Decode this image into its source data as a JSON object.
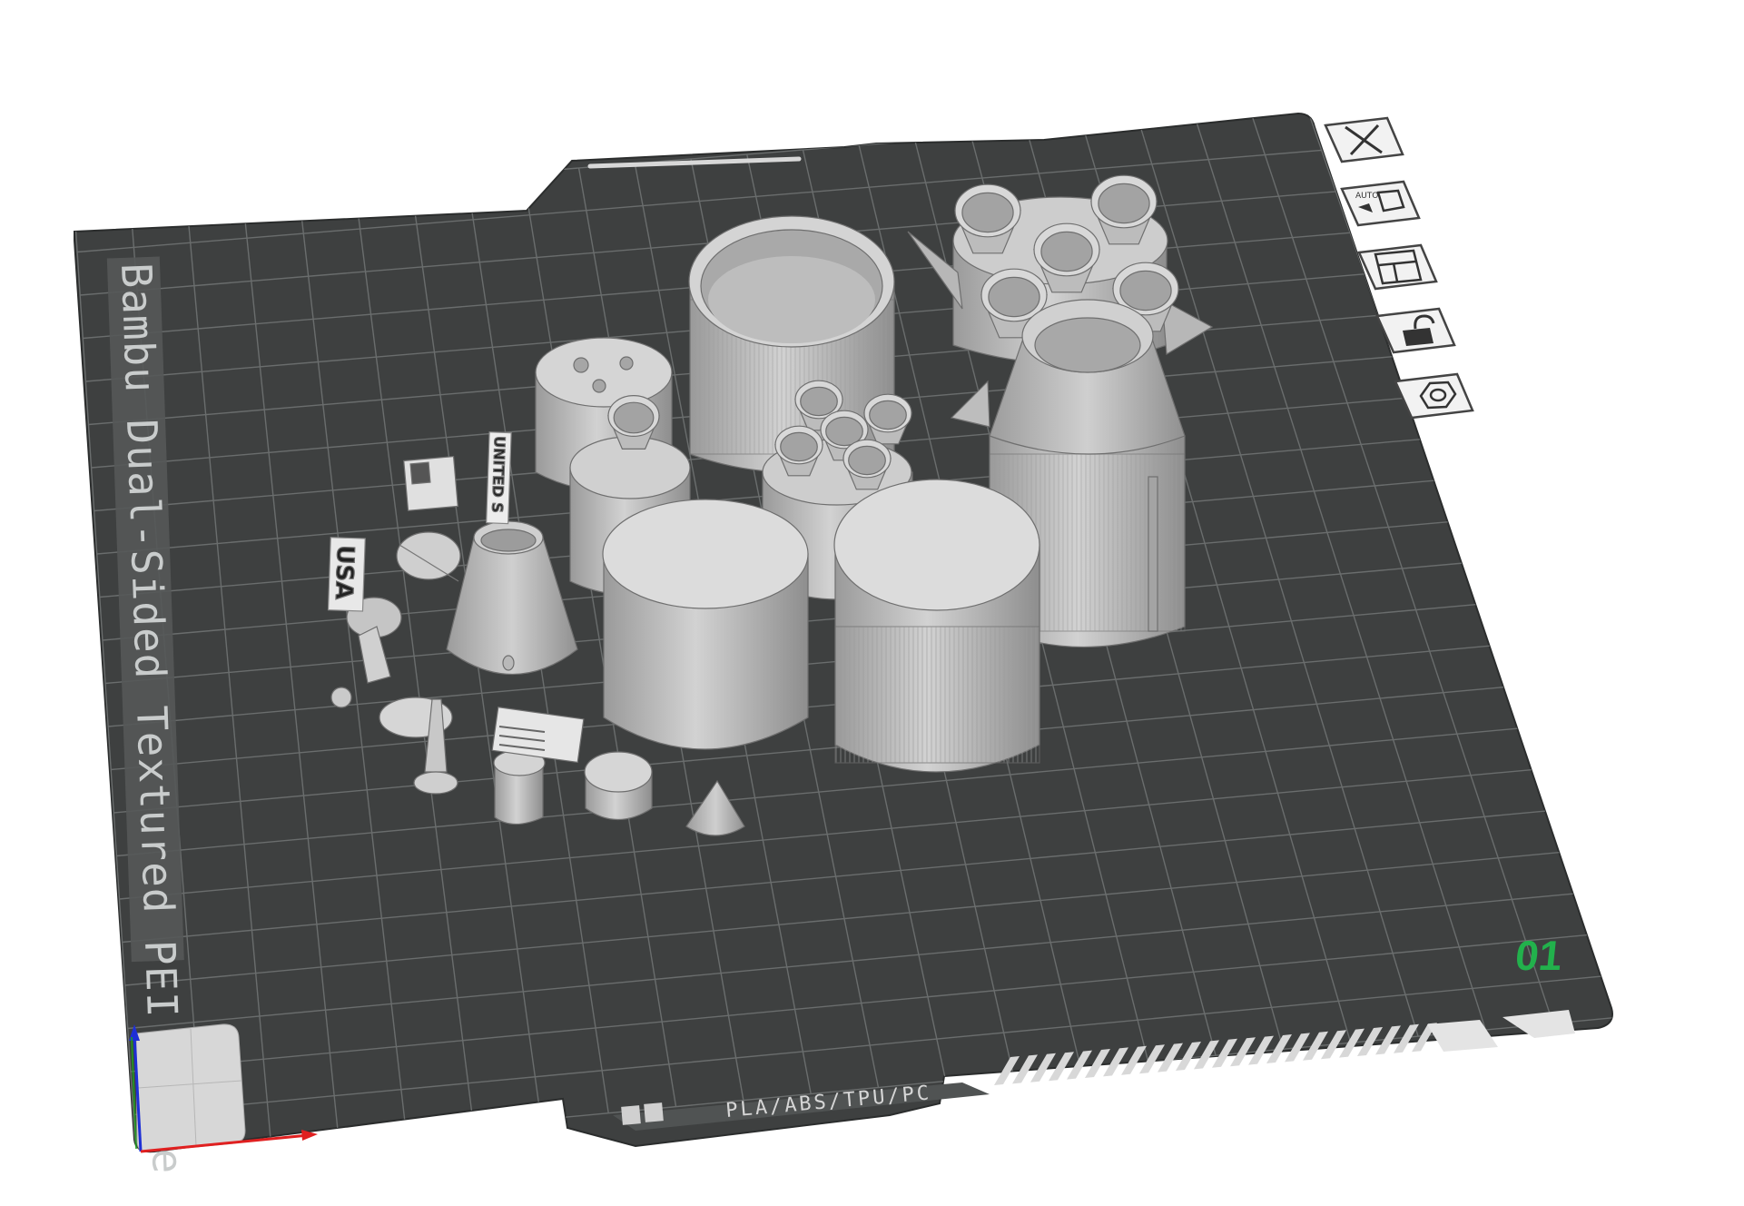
{
  "plate": {
    "name": "Bambu Dual-Sided Textured PEI Plate",
    "index": "01",
    "filament_types": "PLA/ABS/TPU/PC",
    "index_color": "#22b14c",
    "bed_color": "#3e4040",
    "grid_color": "#6a6d6d"
  },
  "toolbar": {
    "buttons": [
      {
        "name": "delete-plate-button",
        "icon": "close-icon"
      },
      {
        "name": "auto-orient-button",
        "icon": "auto-orient-icon",
        "label": "AUTO"
      },
      {
        "name": "arrange-button",
        "icon": "arrange-icon"
      },
      {
        "name": "lock-plate-button",
        "icon": "unlock-icon"
      },
      {
        "name": "plate-settings-button",
        "icon": "hexagon-nut-icon"
      }
    ]
  },
  "model": {
    "part_color": "#c8c8c8",
    "decals": {
      "usa_vertical": "USA",
      "united_states": "UNITED S"
    }
  },
  "axes": {
    "x_color": "#e02020",
    "y_color": "#1fa31f",
    "z_color": "#1e2fd6"
  }
}
